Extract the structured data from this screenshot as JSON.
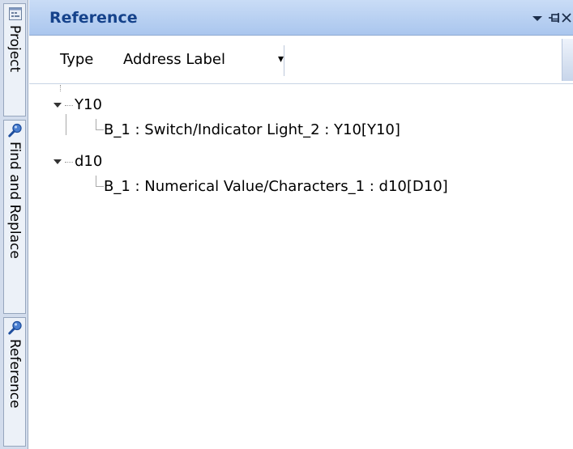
{
  "side_tabs": [
    {
      "label": "Project",
      "icon": "project-icon"
    },
    {
      "label": "Find and Replace",
      "icon": "magnifier-icon"
    },
    {
      "label": "Reference",
      "icon": "magnifier-icon"
    }
  ],
  "panel": {
    "title": "Reference",
    "buttons": [
      "dropdown-icon",
      "pin-icon",
      "close-icon"
    ]
  },
  "toolbar": {
    "type_label": "Type",
    "type_value": "Address Label",
    "dropdown_arrow": "▾"
  },
  "tree": {
    "nodes": [
      {
        "label": "Y10",
        "expanded": true,
        "children": [
          {
            "label": "B_1 : Switch/Indicator Light_2 : Y10[Y10]"
          }
        ]
      },
      {
        "label": "d10",
        "expanded": true,
        "children": [
          {
            "label": "B_1 : Numerical Value/Characters_1 : d10[D10]"
          }
        ]
      }
    ]
  },
  "colors": {
    "title_text": "#15428b",
    "header_bg": "#b6cff1",
    "side_strip": "#d2dcec"
  }
}
